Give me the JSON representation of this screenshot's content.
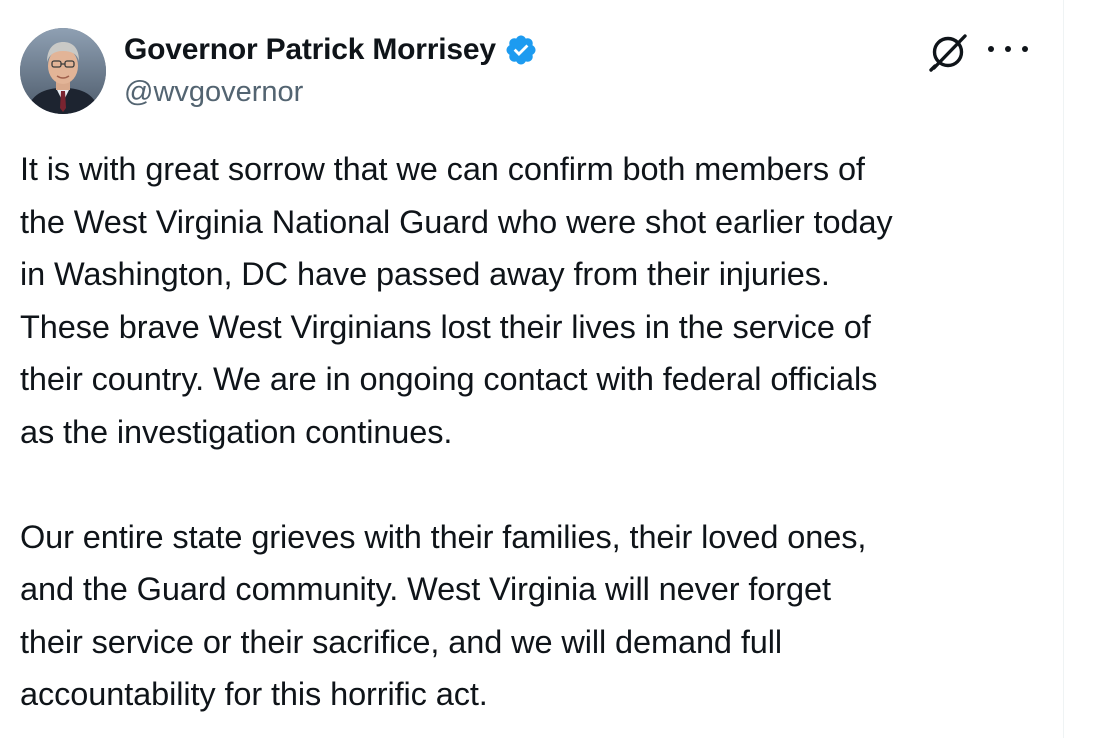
{
  "tweet": {
    "author": {
      "display_name": "Governor Patrick Morrisey",
      "handle": "@wvgovernor",
      "verified": true,
      "verified_color": "#1d9bf0"
    },
    "actions": {
      "grok_icon": "grok-icon",
      "more_icon": "more-icon"
    },
    "paragraphs": [
      {
        "lines": [
          "It is with great sorrow that we can confirm both members of",
          "the West Virginia National Guard who were shot earlier today",
          "in Washington, DC have passed away from their injuries.",
          "These brave West Virginians lost their lives in the service of",
          "their country. We are in ongoing contact with federal officials",
          "as the investigation continues."
        ]
      },
      {
        "lines": [
          "Our entire state grieves with their families, their loved ones,",
          "and the Guard community. West Virginia will never forget",
          "their service or their sacrifice, and we will demand full",
          "accountability for this horrific act."
        ]
      }
    ]
  }
}
